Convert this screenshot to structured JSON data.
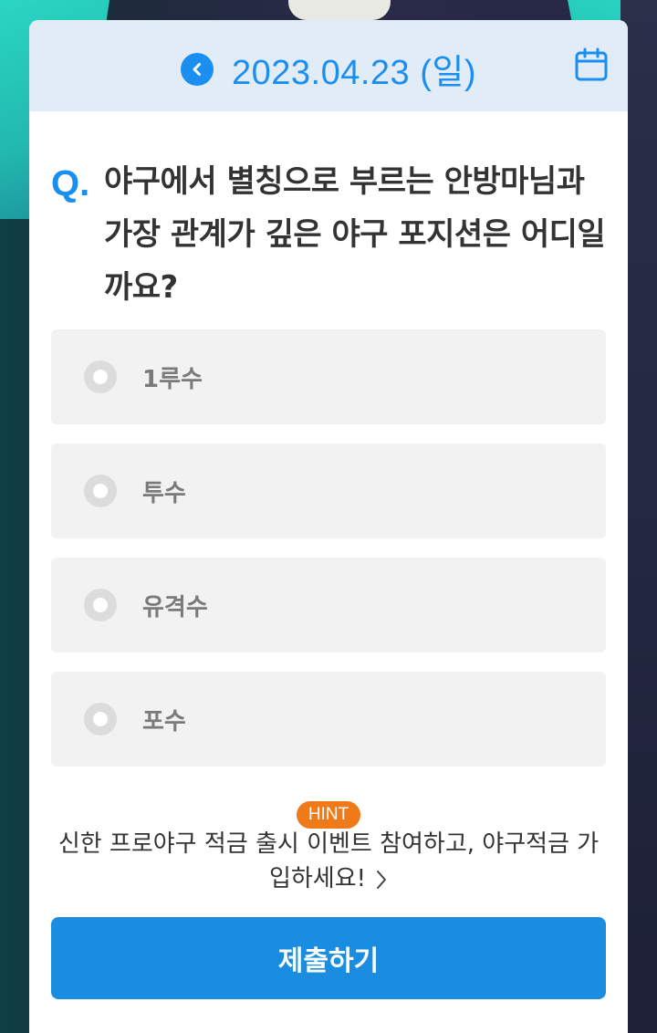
{
  "header": {
    "date": "2023.04.23 (일)"
  },
  "question": {
    "mark": "Q.",
    "text": "야구에서 별칭으로 부르는 안방마님과 가장 관계가 깊은 야구 포지션은 어디일까요?"
  },
  "options": [
    {
      "label": "1루수"
    },
    {
      "label": "투수"
    },
    {
      "label": "유격수"
    },
    {
      "label": "포수"
    }
  ],
  "hint": {
    "badge": "HINT",
    "text": "신한 프로야구 적금 출시 이벤트 참여하고, 야구적금 가입하세요!"
  },
  "submit_label": "제출하기",
  "colors": {
    "accent": "#1a8ff0",
    "hint_badge": "#ee7a1a",
    "header_bg": "#e1ecf7",
    "option_bg": "#f2f2f2"
  },
  "icons": {
    "prev": "chevron-left-icon",
    "calendar": "calendar-icon",
    "hint_arrow": "chevron-right-icon"
  }
}
